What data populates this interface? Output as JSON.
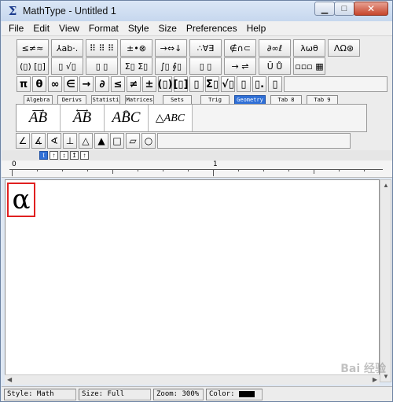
{
  "window": {
    "title": "MathType - Untitled 1"
  },
  "menu": [
    "File",
    "Edit",
    "View",
    "Format",
    "Style",
    "Size",
    "Preferences",
    "Help"
  ],
  "palette_row1": [
    "≤≠≈",
    "⅄ab·.",
    "⠿ ⠿ ⠿",
    "±•⊗",
    "→⇔↓",
    "∴∀∃",
    "∉∩⊂",
    "∂∞ℓ",
    "λωθ",
    "ΛΩ⊛"
  ],
  "palette_row2": [
    "(▯) [▯]",
    "▯ √▯",
    "▯ ▯",
    "Σ▯ Σ▯",
    "∫▯ ∮▯",
    "▯ ▯",
    "→ ⇌",
    "Ū Ů",
    "▫▫▫ ▦",
    "",
    "",
    ""
  ],
  "symbols": [
    "π",
    "θ",
    "∞",
    "∈",
    "→",
    "∂",
    "≤",
    "≠",
    "±",
    "(▯)",
    "[▯]",
    "▯",
    "Σ▯",
    "√▯",
    "▯",
    "▯.",
    "▯"
  ],
  "tabs": [
    "Algebra",
    "Derivs",
    "Statisti",
    "Matrices",
    "Sets",
    "Trig",
    "Geometry",
    "Tab 8",
    "Tab 9"
  ],
  "active_tab": "Geometry",
  "templates": [
    {
      "text": "AB",
      "over": "⟶"
    },
    {
      "text": "AB",
      "over": "⟷"
    },
    {
      "text": "ABC",
      "over": "⌢"
    },
    {
      "text": "△ABC",
      "over": ""
    }
  ],
  "geometry_symbols": [
    "∠",
    "∡",
    "∢",
    "⊥",
    "△",
    "▲",
    "□",
    "▱",
    "○"
  ],
  "nudge_buttons": [
    "t",
    "↑",
    "↕",
    "↥",
    "↑"
  ],
  "ruler": {
    "labels": [
      "0",
      "1"
    ]
  },
  "editor": {
    "content": "α"
  },
  "status": {
    "style": "Style: Math",
    "size": "Size: Full",
    "zoom": "Zoom: 300%",
    "color": "Color:",
    "color_value": "#000000"
  },
  "watermark": "Bai 经验"
}
